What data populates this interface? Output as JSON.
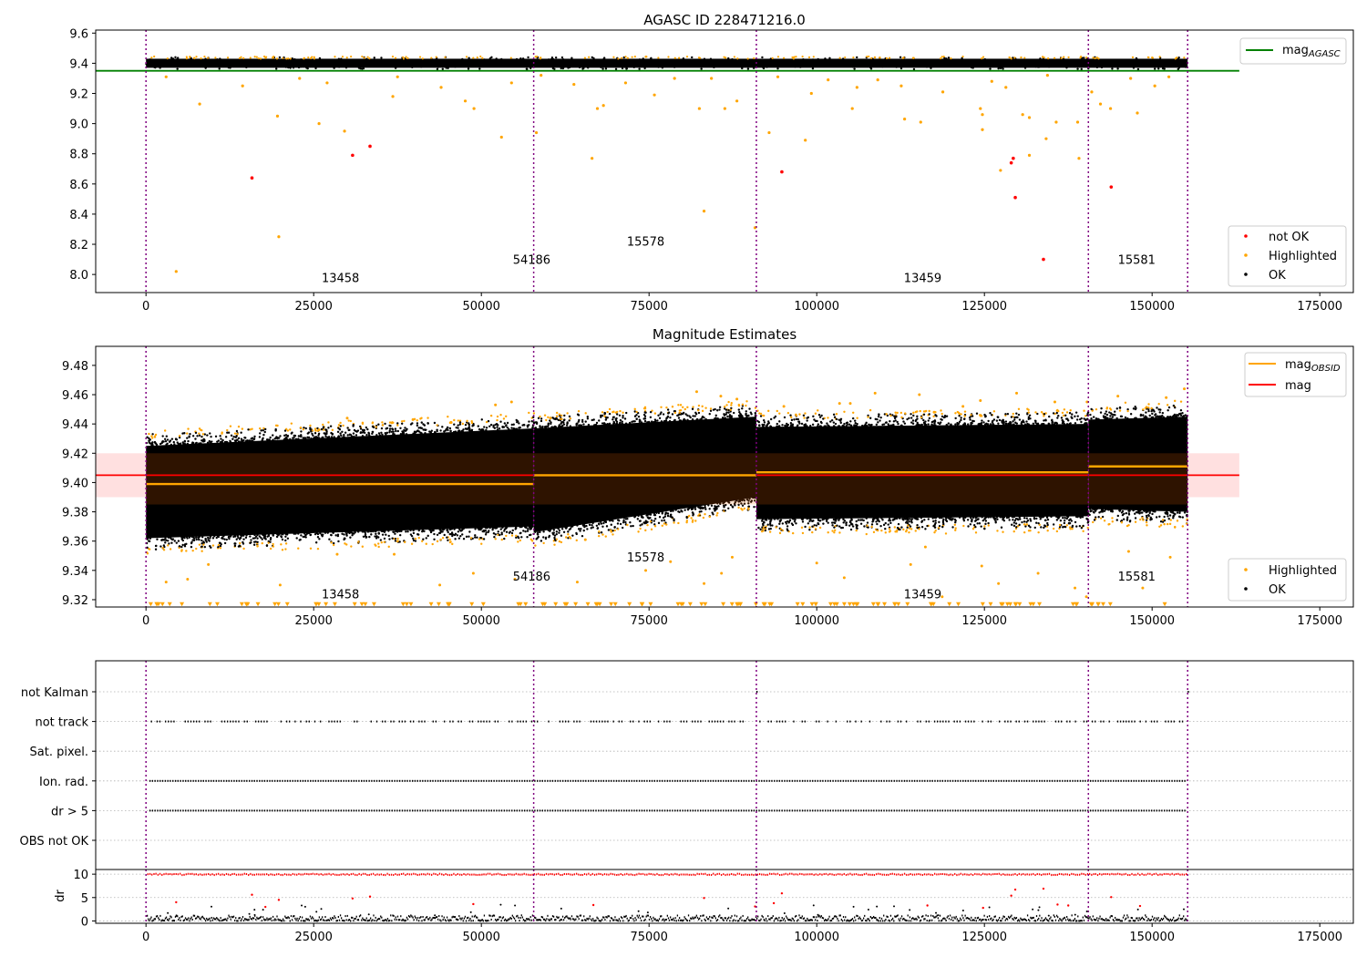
{
  "chart_data": [
    {
      "panel": "top",
      "type": "scatter",
      "title": "AGASC ID 228471216.0",
      "xlim": [
        -7500,
        180000
      ],
      "ylim": [
        7.88,
        9.62
      ],
      "xticks": [
        0,
        25000,
        50000,
        75000,
        100000,
        125000,
        150000,
        175000
      ],
      "yticks": [
        8.0,
        8.2,
        8.4,
        8.6,
        8.8,
        9.0,
        9.2,
        9.4,
        9.6
      ],
      "ytick_labels": [
        "8.0",
        "8.2",
        "8.4",
        "8.6",
        "8.8",
        "9.0",
        "9.2",
        "9.4",
        "9.6"
      ],
      "reference_line": {
        "name": "mag",
        "subscript": "AGASC",
        "y": 9.35,
        "x_range": [
          -7500,
          163000
        ],
        "color": "#008000"
      },
      "obsid_boundaries": [
        0,
        57800,
        91000,
        140500,
        155300
      ],
      "obsid_labels": [
        {
          "text": "13458",
          "x": 29000,
          "y": 7.95
        },
        {
          "text": "54186",
          "x": 57500,
          "y": 8.07
        },
        {
          "text": "15578",
          "x": 74500,
          "y": 8.19
        },
        {
          "text": "13459",
          "x": 115800,
          "y": 7.95
        },
        {
          "text": "15581",
          "x": 147700,
          "y": 8.07
        }
      ],
      "ok_band": {
        "x_range": [
          0,
          155300
        ],
        "y_range": [
          9.37,
          9.43
        ],
        "color": "#000000"
      },
      "series": [
        {
          "name": "not OK",
          "color": "#ff0000",
          "points": [
            [
              15800,
              8.64
            ],
            [
              30800,
              8.79
            ],
            [
              33400,
              8.85
            ],
            [
              94800,
              8.68
            ],
            [
              129000,
              8.74
            ],
            [
              129300,
              8.77
            ],
            [
              129600,
              8.51
            ],
            [
              133800,
              8.1
            ],
            [
              143900,
              8.58
            ]
          ]
        },
        {
          "name": "Highlighted",
          "color": "#ffa500",
          "points": [
            [
              4500,
              8.02
            ],
            [
              19800,
              8.25
            ],
            [
              83200,
              8.42
            ],
            [
              90800,
              8.31
            ],
            [
              19600,
              9.05
            ],
            [
              25800,
              9.0
            ],
            [
              29600,
              8.95
            ],
            [
              53000,
              8.91
            ],
            [
              58200,
              8.94
            ],
            [
              66500,
              8.77
            ],
            [
              98300,
              8.89
            ],
            [
              92900,
              8.94
            ],
            [
              127400,
              8.69
            ],
            [
              131700,
              8.79
            ],
            [
              134200,
              8.9
            ],
            [
              139100,
              8.77
            ],
            [
              135700,
              9.01
            ],
            [
              138900,
              9.01
            ],
            [
              124700,
              8.96
            ],
            [
              124700,
              9.06
            ],
            [
              124400,
              9.1
            ],
            [
              113100,
              9.03
            ],
            [
              115500,
              9.01
            ],
            [
              105300,
              9.1
            ],
            [
              130700,
              9.06
            ],
            [
              131700,
              9.04
            ],
            [
              8000,
              9.13
            ],
            [
              14400,
              9.25
            ],
            [
              3000,
              9.31
            ],
            [
              36800,
              9.18
            ],
            [
              47600,
              9.15
            ],
            [
              48900,
              9.1
            ],
            [
              54500,
              9.27
            ],
            [
              67300,
              9.1
            ],
            [
              68200,
              9.12
            ],
            [
              75800,
              9.19
            ],
            [
              82500,
              9.1
            ],
            [
              86300,
              9.1
            ],
            [
              88100,
              9.15
            ],
            [
              99200,
              9.2
            ],
            [
              101700,
              9.29
            ],
            [
              109100,
              9.29
            ],
            [
              118800,
              9.21
            ],
            [
              141000,
              9.21
            ],
            [
              142300,
              9.13
            ],
            [
              143800,
              9.1
            ],
            [
              146800,
              9.3
            ],
            [
              147800,
              9.07
            ],
            [
              150400,
              9.25
            ],
            [
              152500,
              9.31
            ],
            [
              22900,
              9.3
            ],
            [
              27000,
              9.27
            ],
            [
              37500,
              9.31
            ],
            [
              44000,
              9.24
            ],
            [
              58900,
              9.32
            ],
            [
              63800,
              9.26
            ],
            [
              71500,
              9.27
            ],
            [
              78800,
              9.3
            ],
            [
              84300,
              9.3
            ],
            [
              94200,
              9.31
            ],
            [
              106000,
              9.24
            ],
            [
              112600,
              9.25
            ],
            [
              126100,
              9.28
            ],
            [
              128200,
              9.24
            ],
            [
              134400,
              9.32
            ]
          ]
        }
      ],
      "legends": [
        {
          "position": "top-right",
          "entries": [
            {
              "label": "mag",
              "subscript": "AGASC",
              "kind": "line",
              "color": "#008000"
            }
          ]
        },
        {
          "position": "bottom-right",
          "entries": [
            {
              "label": "not OK",
              "kind": "dot",
              "color": "#ff0000"
            },
            {
              "label": "Highlighted",
              "kind": "dot",
              "color": "#ffa500"
            },
            {
              "label": "OK",
              "kind": "dot",
              "color": "#000000"
            }
          ]
        }
      ]
    },
    {
      "panel": "middle",
      "type": "scatter",
      "title": "Magnitude Estimates",
      "xlim": [
        -7500,
        180000
      ],
      "ylim": [
        9.315,
        9.493
      ],
      "xticks": [
        0,
        25000,
        50000,
        75000,
        100000,
        125000,
        150000,
        175000
      ],
      "yticks": [
        9.32,
        9.34,
        9.36,
        9.38,
        9.4,
        9.42,
        9.44,
        9.46,
        9.48
      ],
      "ytick_labels": [
        "9.32",
        "9.34",
        "9.36",
        "9.38",
        "9.40",
        "9.42",
        "9.44",
        "9.46",
        "9.48"
      ],
      "mag": {
        "name": "mag",
        "y": 9.405,
        "band": [
          9.39,
          9.42
        ],
        "x_range": [
          -7500,
          163000
        ],
        "color": "#ff0000"
      },
      "mag_obsid": [
        {
          "x_range": [
            0,
            57800
          ],
          "y": 9.399
        },
        {
          "x_range": [
            57800,
            91000
          ],
          "y": 9.405
        },
        {
          "x_range": [
            91000,
            140500
          ],
          "y": 9.407
        },
        {
          "x_range": [
            140500,
            155300
          ],
          "y": 9.411
        }
      ],
      "obsid_boundaries": [
        0,
        57800,
        91000,
        140500,
        155300
      ],
      "obsid_labels": [
        {
          "text": "13458",
          "x": 29000,
          "y": 9.321
        },
        {
          "text": "54186",
          "x": 57500,
          "y": 9.333
        },
        {
          "text": "15578",
          "x": 74500,
          "y": 9.346
        },
        {
          "text": "13459",
          "x": 115800,
          "y": 9.321
        },
        {
          "text": "15581",
          "x": 147700,
          "y": 9.333
        }
      ],
      "ok_cloud": [
        {
          "x_range": [
            0,
            57800
          ],
          "y_start": [
            9.362,
            9.425
          ],
          "y_end": [
            9.37,
            9.437
          ]
        },
        {
          "x_range": [
            57800,
            91000
          ],
          "y_start": [
            9.366,
            9.437
          ],
          "y_end": [
            9.39,
            9.445
          ]
        },
        {
          "x_range": [
            91000,
            140500
          ],
          "y_start": [
            9.375,
            9.438
          ],
          "y_end": [
            9.377,
            9.44
          ]
        },
        {
          "x_range": [
            140500,
            155300
          ],
          "y_start": [
            9.382,
            9.443
          ],
          "y_end": [
            9.38,
            9.445
          ]
        }
      ],
      "series": [
        {
          "name": "Highlighted",
          "color": "#ffa500",
          "points": [
            [
              20000,
              9.33
            ],
            [
              48800,
              9.338
            ],
            [
              55000,
              9.334
            ],
            [
              64300,
              9.332
            ],
            [
              74500,
              9.34
            ],
            [
              78200,
              9.346
            ],
            [
              85800,
              9.338
            ],
            [
              87400,
              9.349
            ],
            [
              83200,
              9.331
            ],
            [
              100000,
              9.345
            ],
            [
              104100,
              9.335
            ],
            [
              114000,
              9.344
            ],
            [
              116200,
              9.356
            ],
            [
              118700,
              9.322
            ],
            [
              124600,
              9.343
            ],
            [
              127100,
              9.331
            ],
            [
              133000,
              9.338
            ],
            [
              138500,
              9.328
            ],
            [
              140200,
              9.322
            ],
            [
              146500,
              9.353
            ],
            [
              148600,
              9.328
            ],
            [
              152700,
              9.349
            ],
            [
              3000,
              9.332
            ],
            [
              6200,
              9.334
            ],
            [
              9300,
              9.344
            ],
            [
              37000,
              9.351
            ],
            [
              43800,
              9.33
            ],
            [
              65500,
              9.361
            ],
            [
              28500,
              9.351
            ],
            [
              25800,
              9.436
            ],
            [
              30000,
              9.444
            ],
            [
              39800,
              9.443
            ],
            [
              45500,
              9.441
            ],
            [
              52100,
              9.453
            ],
            [
              54500,
              9.455
            ],
            [
              60300,
              9.444
            ],
            [
              82100,
              9.462
            ],
            [
              85700,
              9.459
            ],
            [
              88100,
              9.457
            ],
            [
              95100,
              9.452
            ],
            [
              103400,
              9.454
            ],
            [
              105000,
              9.454
            ],
            [
              108700,
              9.461
            ],
            [
              115300,
              9.46
            ],
            [
              117500,
              9.448
            ],
            [
              121800,
              9.452
            ],
            [
              124400,
              9.456
            ],
            [
              129800,
              9.461
            ],
            [
              135500,
              9.455
            ],
            [
              140300,
              9.455
            ],
            [
              144900,
              9.459
            ],
            [
              152100,
              9.458
            ],
            [
              154800,
              9.464
            ]
          ]
        }
      ],
      "clipped_markers_y": 9.317,
      "legends": [
        {
          "position": "top-right",
          "entries": [
            {
              "label": "mag",
              "subscript": "OBSID",
              "kind": "line",
              "color": "#ffa500"
            },
            {
              "label": "mag",
              "kind": "line",
              "color": "#ff0000"
            }
          ]
        },
        {
          "position": "bottom-right",
          "entries": [
            {
              "label": "Highlighted",
              "kind": "dot",
              "color": "#ffa500"
            },
            {
              "label": "OK",
              "kind": "dot",
              "color": "#000000"
            }
          ]
        }
      ]
    },
    {
      "panel": "flags",
      "type": "scatter",
      "xlim": [
        -7500,
        180000
      ],
      "categories": [
        "not Kalman",
        "not track",
        "Sat. pixel.",
        "Ion. rad.",
        "dr > 5",
        "OBS not OK"
      ],
      "obsid_boundaries": [
        0,
        57800,
        91000,
        140500,
        155300
      ],
      "flag_rows": [
        {
          "category": "not Kalman",
          "pattern": "sparse"
        },
        {
          "category": "not track",
          "pattern": "dashed"
        },
        {
          "category": "Sat. pixel.",
          "pattern": "none"
        },
        {
          "category": "Ion. rad.",
          "pattern": "dense"
        },
        {
          "category": "dr > 5",
          "pattern": "dense"
        },
        {
          "category": "OBS not OK",
          "pattern": "none"
        }
      ]
    },
    {
      "panel": "dr",
      "type": "scatter",
      "ylabel": "dr",
      "xlim": [
        -7500,
        180000
      ],
      "ylim": [
        -0.5,
        11
      ],
      "xticks": [
        0,
        25000,
        50000,
        75000,
        100000,
        125000,
        150000,
        175000
      ],
      "yticks": [
        0,
        5,
        10
      ],
      "ytick_labels": [
        "0",
        "5",
        "10"
      ],
      "obsid_boundaries": [
        0,
        57800,
        91000,
        140500,
        155300
      ],
      "series": [
        {
          "name": "dr capped",
          "color": "#ff0000",
          "y": 10
        },
        {
          "name": "dr > 5",
          "color": "#ff0000",
          "points": [
            [
              4500,
              4.0
            ],
            [
              15800,
              5.6
            ],
            [
              17800,
              3.0
            ],
            [
              19800,
              4.5
            ],
            [
              30800,
              4.8
            ],
            [
              33400,
              5.2
            ],
            [
              48800,
              3.6
            ],
            [
              66700,
              3.4
            ],
            [
              83200,
              4.9
            ],
            [
              90800,
              3.1
            ],
            [
              93600,
              3.8
            ],
            [
              94800,
              5.9
            ],
            [
              116500,
              3.3
            ],
            [
              124800,
              2.8
            ],
            [
              129000,
              5.4
            ],
            [
              129600,
              6.7
            ],
            [
              133800,
              6.9
            ],
            [
              135900,
              3.5
            ],
            [
              137500,
              3.3
            ],
            [
              143900,
              5.1
            ],
            [
              148200,
              3.2
            ]
          ]
        },
        {
          "name": "OK",
          "color": "#000000",
          "y_range": [
            0,
            1.2
          ]
        }
      ]
    }
  ]
}
